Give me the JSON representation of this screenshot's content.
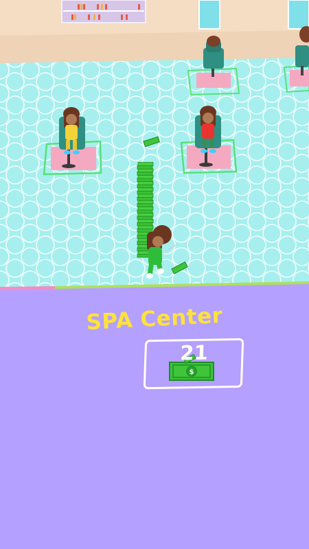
{
  "zone": {
    "title": "SPA Center",
    "cost": "21",
    "currency_icon": "cash-bill-icon"
  },
  "player": {
    "money_stack_count": 30
  },
  "colors": {
    "floor": "#a8f0ee",
    "zone_panel": "#b4a0ff",
    "title_text": "#ffe23a",
    "cash": "#3fc43a",
    "station_mat": "#f5a9c0"
  }
}
